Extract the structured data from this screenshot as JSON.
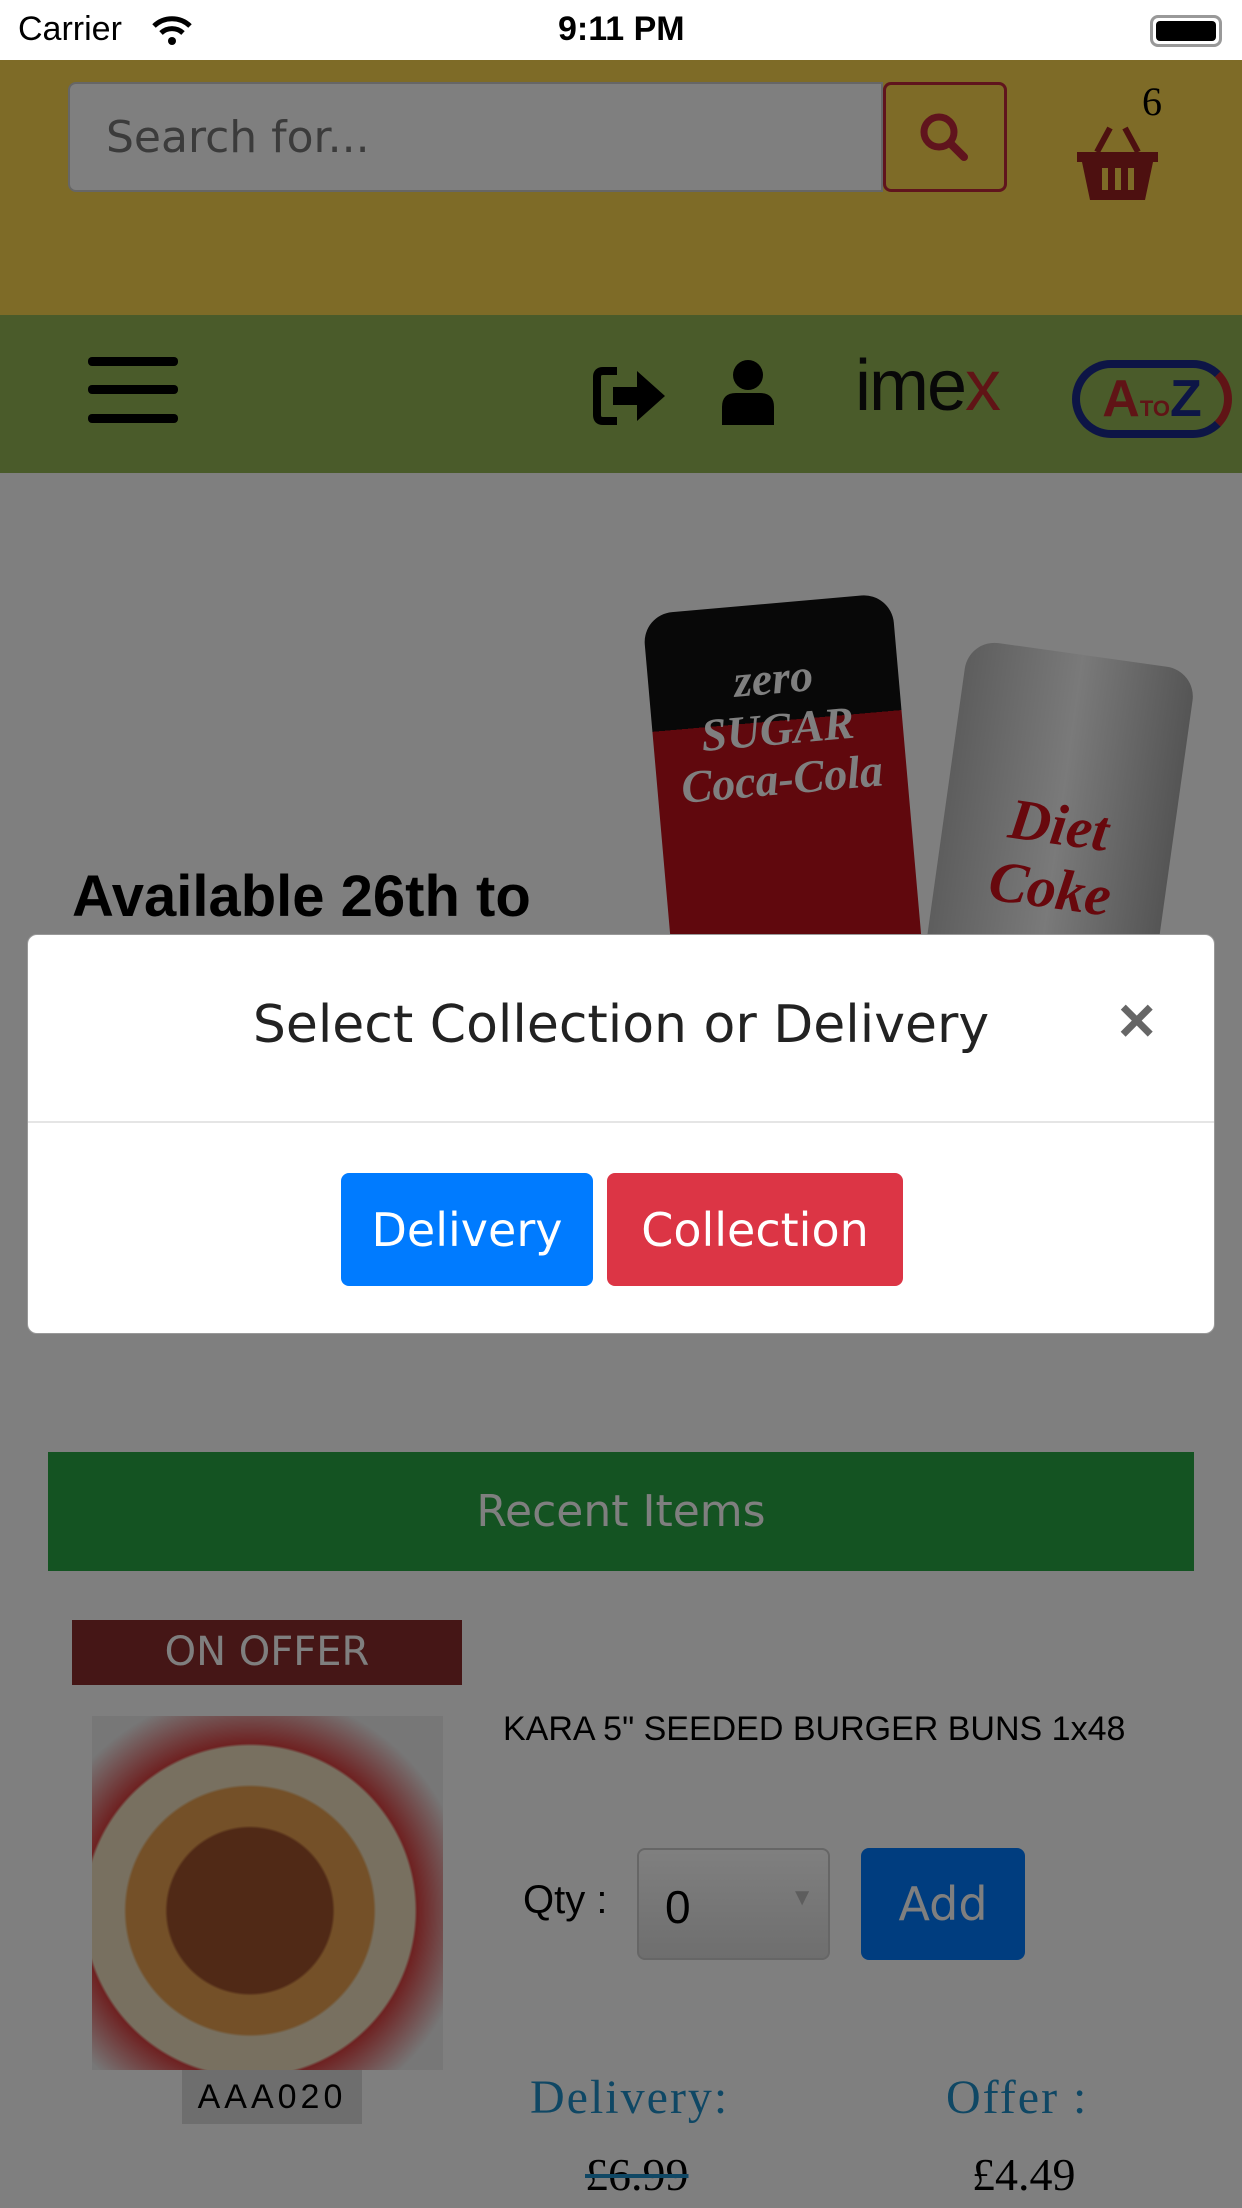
{
  "status_bar": {
    "carrier": "Carrier",
    "time": "9:11 PM"
  },
  "header": {
    "search_placeholder": "Search for...",
    "cart_count": "6",
    "brand_logos": [
      "imex",
      "A TO Z"
    ]
  },
  "colors": {
    "header_yellow": "#fcd64e",
    "nav_green": "#94b654",
    "delivery_blue": "#007bff",
    "collection_red": "#dc3545",
    "recent_green": "#28a745",
    "offer_red": "#8b2d2d"
  },
  "banner": {
    "text": "Available 26th to",
    "cans": [
      "zero SUGAR Coca-Cola",
      "Diet Coke"
    ]
  },
  "modal": {
    "title": "Select Collection or Delivery",
    "close": "×",
    "delivery_label": "Delivery",
    "collection_label": "Collection"
  },
  "recent": {
    "heading": "Recent Items"
  },
  "product": {
    "badge": "ON OFFER",
    "name": "KARA 5\" SEEDED BURGER BUNS 1x48",
    "code": "AAA020",
    "qty_label": "Qty :",
    "qty_value": "0",
    "add_label": "Add",
    "delivery_label": "Delivery:",
    "delivery_price": "£6.99",
    "offer_label": "Offer :",
    "offer_price": "£4.49"
  }
}
